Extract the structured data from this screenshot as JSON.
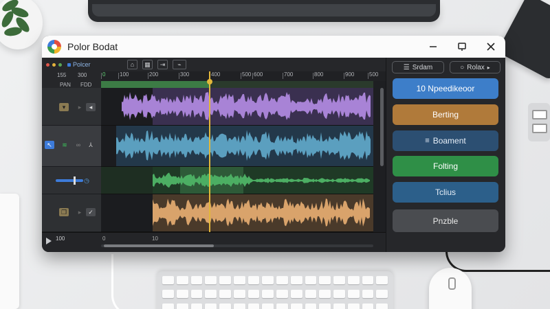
{
  "window": {
    "title": "Polor Bodat",
    "controls": [
      "minimize",
      "maximize",
      "close"
    ]
  },
  "toolbar": {
    "label": "Polcer",
    "tools": [
      "select-icon",
      "grid-icon",
      "split-icon",
      "snap-icon"
    ]
  },
  "track_header": {
    "numbers_top": [
      "155",
      "300"
    ],
    "numbers_bottom": [
      "PAN",
      "FDD"
    ]
  },
  "ruler": {
    "ticks": [
      "0",
      "100",
      "200",
      "300",
      "400",
      "500",
      "600",
      "700",
      "800",
      "900",
      "500"
    ]
  },
  "tracks": [
    {
      "name": "track-1",
      "color": "#a883d6"
    },
    {
      "name": "track-2",
      "color": "#5b9fbf"
    },
    {
      "name": "track-3",
      "color": "#4cae63"
    },
    {
      "name": "track-4",
      "color": "#d9a36b"
    }
  ],
  "footer": {
    "time": "100",
    "bottom_labels": [
      "0",
      "10"
    ]
  },
  "panel": {
    "pills": [
      {
        "label": "Srdam",
        "icon": "list-icon"
      },
      {
        "label": "Rolax",
        "icon": "circle-icon"
      }
    ],
    "buttons": [
      {
        "label": "10 Npeedikeoor",
        "color": "#3d7ec9"
      },
      {
        "label": "Berting",
        "color": "#b07a3a"
      },
      {
        "label": "Boament",
        "color": "#2c4f72",
        "icon": "menu-icon"
      },
      {
        "label": "Folting",
        "color": "#2f8f47"
      },
      {
        "label": "Tclius",
        "color": "#2c5f8a"
      },
      {
        "label": "Pnzble",
        "color": "#4a4c50"
      }
    ]
  }
}
